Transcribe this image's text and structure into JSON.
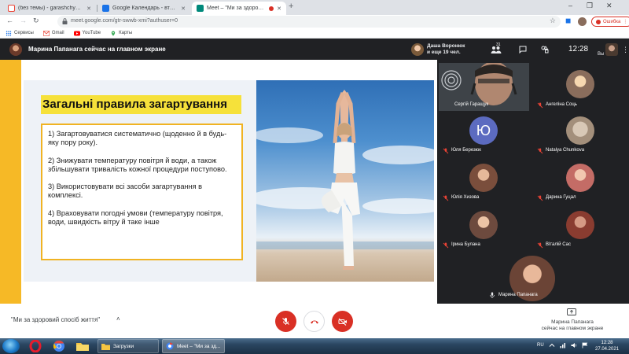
{
  "browser": {
    "tabs": [
      {
        "title": "(без темы) - garashchyksergi@gm",
        "favicon_color": "#ea4335"
      },
      {
        "title": "Google Календарь - вторник, 27",
        "favicon_color": "#1a73e8"
      },
      {
        "title": "Meet – \"Ми за здоровий сп",
        "favicon_color": "#00897b",
        "active": true
      }
    ],
    "new_tab": "+",
    "url": "meet.google.com/gtr-swwb-xmi?authuser=0",
    "error_button": "Ошибка",
    "bookmarks": [
      {
        "label": "Сервисы",
        "icon": "apps-grid-icon"
      },
      {
        "label": "Gmail",
        "icon": "gmail-icon"
      },
      {
        "label": "YouTube",
        "icon": "youtube-icon"
      },
      {
        "label": "Карты",
        "icon": "maps-icon"
      }
    ]
  },
  "meet_header": {
    "presenter_title": "Марина Папанага сейчас на главном экране",
    "participants_line1": "Даша Воронюк",
    "participants_line2": "и еще 19 чел.",
    "people_count": "31",
    "time": "12:28",
    "self_label": "Вы"
  },
  "slide": {
    "title": "Загальні правила загартування",
    "rules": [
      "1) Загартовуватися систематично (щоденно й в будь-яку пору року).",
      "2) Знижувати температуру повітря й води, а також збільшувати тривалість кожної процедури поступово.",
      "3) Використовувати всі засоби загартування в комплексі.",
      "4) Враховувати погодні умови (температуру повітря, води, швидкість вітру й таке інше"
    ]
  },
  "participants": [
    {
      "name": "Сергій Гаращук",
      "muted": false,
      "avatar_color": "#5a4a3f"
    },
    {
      "name": "Ангеліна Соць",
      "muted": true,
      "avatar_color": "#8a6d5c"
    },
    {
      "name": "Юля Березюк",
      "muted": true,
      "initial": "Ю",
      "avatar_color": "#5c6bc0"
    },
    {
      "name": "Natalya Chunkova",
      "muted": true,
      "avatar_color": "#b9a796"
    },
    {
      "name": "Юлія Хизова",
      "muted": true,
      "avatar_color": "#7a4e3c"
    },
    {
      "name": "Дарина Гуцал",
      "muted": true,
      "avatar_color": "#c46c66"
    },
    {
      "name": "Ірина Булана",
      "muted": true,
      "avatar_color": "#6d4a3e"
    },
    {
      "name": "Віталій Сас",
      "muted": true,
      "avatar_color": "#8a3c30"
    },
    {
      "name": "Марина Папанага",
      "muted": false,
      "avatar_color": "#6b4436"
    }
  ],
  "bottom_bar": {
    "meeting_name": "\"Ми за здоровий спосіб життя\"",
    "caret": "˄",
    "presenter_line1": "Марина Папанага",
    "presenter_line2": "сейчас на главном экране"
  },
  "taskbar": {
    "window1": "Загрузки",
    "window2": "Meet – \"Ми за зд...",
    "lang": "RU",
    "time": "12:28",
    "date": "27.04.2021"
  },
  "colors": {
    "accent_red": "#d93025",
    "slide_yellow": "#f6b926",
    "title_highlight": "#f6e13a",
    "meet_dark": "#202124"
  }
}
